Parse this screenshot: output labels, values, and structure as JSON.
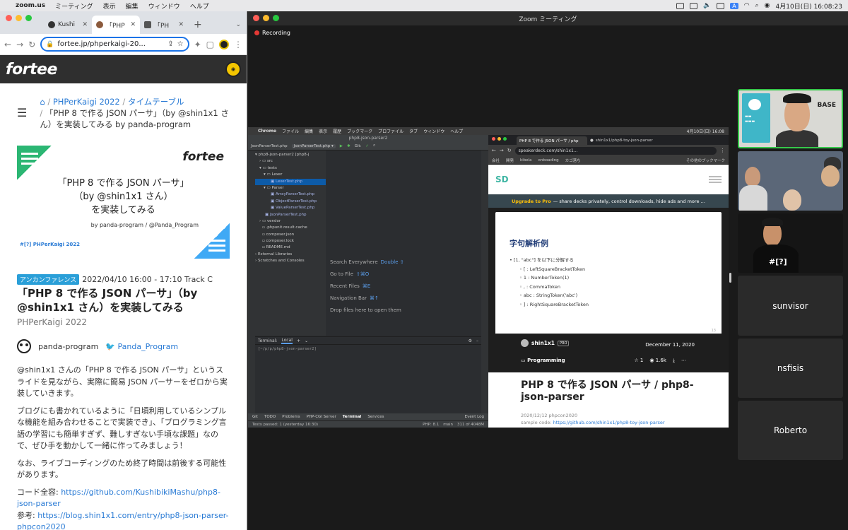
{
  "menubar": {
    "app": "zoom.us",
    "items": [
      "ミーティング",
      "表示",
      "編集",
      "ウィンドウ",
      "ヘルプ"
    ],
    "datetime": "4月10日(日)  16:08:23",
    "input_badge": "A"
  },
  "browser": {
    "tabs": [
      {
        "label": "Kushi"
      },
      {
        "label": "「PHP"
      },
      {
        "label": "「PH"
      }
    ],
    "url": "fortee.jp/phperkaigi-20...",
    "site_logo": "fortee",
    "breadcrumb": {
      "item1": "PHPerKaigi 2022",
      "item2": "タイムテーブル",
      "current": "「PHP 8 で作る JSON パーサ」（by @shin1x1 さん）を実装してみる by panda-program"
    },
    "banner": {
      "brand": "fortee",
      "line1": "「PHP 8 で作る JSON パーサ」",
      "line2": "（by @shin1x1 さん）",
      "line3": "を実装してみる",
      "author": "by panda-program / @Panda_Program",
      "event": "#[?] PHPerKaigi 2022"
    },
    "talk": {
      "badge": "アンカンファレンス",
      "when": "2022/04/10 16:00 - 17:10 Track C",
      "title": "「PHP 8 で作る JSON パーサ」（by @shin1x1 さん）を実装してみる",
      "event": "PHPerKaigi 2022",
      "speaker": "panda-program",
      "twitter": "Panda_Program"
    },
    "desc": {
      "p1": "@shin1x1 さんの「PHP 8 で作る JSON パーサ」というスライドを見ながら、実際に簡易 JSON パーサーをゼロから実装していきます。",
      "p2": "ブログにも書かれているように「日頃利用しているシンプルな機能を組み合わせることで実装でき」、「プログラミング言語の学習にも簡単すぎず、難しすぎない手頃な課題」なので、ぜひ手を動かして一緒に作ってみましょう！",
      "p3": "なお、ライブコーディングのため終了時間は前後する可能性があります。",
      "code_label": "コード全容: ",
      "code_link": "https://github.com/KushibikiMashu/php8-json-parser",
      "ref_label": "参考: ",
      "ref_link": "https://blog.shin1x1.com/entry/php8-json-parser-phpcon2020"
    }
  },
  "zoom": {
    "title": "Zoom ミーティング",
    "recording": "Recording",
    "participants": [
      "sunvisor",
      "nsfisis",
      "Roberto"
    ],
    "tile1_logo": "BASE"
  },
  "share": {
    "menubar": {
      "app": "Chrome",
      "items": [
        "ファイル",
        "編集",
        "表示",
        "履歴",
        "ブックマーク",
        "プロファイル",
        "タブ",
        "ウィンドウ",
        "ヘルプ"
      ],
      "datetime": "4月10日(日)  16:08"
    },
    "ide": {
      "title": "php8-json-parser2",
      "file_tab": "JsonParserTest.php",
      "run_config": "JsonParserTest.php ▾",
      "tree": [
        "php8-json-parser2 [php8-j",
        "src",
        "tests",
        "Lexer",
        "LexerTest.php",
        "Parser",
        "ArrayParserTest.php",
        "ObjectParserTest.php",
        "ValueParserTest.php",
        "JsonParserTest.php",
        "vendor",
        ".phpunit.result.cache",
        "composer.json",
        "composer.lock",
        "README.md",
        "External Libraries",
        "Scratches and Consoles"
      ],
      "hints": [
        {
          "label": "Search Everywhere",
          "key": "Double ⇧"
        },
        {
          "label": "Go to File",
          "key": "⇧⌘O"
        },
        {
          "label": "Recent Files",
          "key": "⌘E"
        },
        {
          "label": "Navigation Bar",
          "key": "⌘↑"
        },
        {
          "label": "Drop files here to open them",
          "key": ""
        }
      ],
      "terminal_tab": "Terminal:",
      "terminal_local": "Local",
      "terminal_line": "[~/p/p/php8-json-parser2] ",
      "bottom_tabs": [
        "Git",
        "TODO",
        "Problems",
        "PHP-CGI Server",
        "Terminal",
        "Services",
        "Event Log"
      ],
      "status": "Tests passed: 1 (yesterday 16:30)",
      "status_right": [
        "PHP: 8.1",
        "main",
        "311 of 4048M"
      ]
    },
    "chrome": {
      "tabs": [
        "PHP 8 で作る JSON パーサ / php",
        "shin1x1/php8-toy-json-parser"
      ],
      "url": "speakerdeck.com/shin1x1...",
      "bookmarks": [
        "会社",
        "開発",
        "kibela",
        "onboading",
        "カゴ落ち",
        "その他のブックマーク"
      ],
      "logo": "SD",
      "upgrade_hl": "Upgrade to Pro",
      "upgrade_rest": "— share decks privately, control downloads, hide ads and more …",
      "slide": {
        "title": "字句解析例",
        "items": [
          "[1, \"abc\"] を以下に分解する",
          "[ : LeftSquareBracketToken",
          "1 : NumberToken(1)",
          ", : CommaToken",
          "abc : StringToken('abc')",
          "] : RightSquareBracketToken"
        ],
        "num": "13"
      },
      "deck": {
        "author": "shin1x1",
        "pro": "PRO",
        "date": "December 11, 2020",
        "category": "Programming",
        "stars": "1",
        "views": "1.6k",
        "title": "PHP 8 で作る JSON パーサ / php8-json-parser",
        "sub": "2020/12/12 phpcon2020",
        "sample_label": "sample code: ",
        "sample_link": "https://github.com/shin1x1/php8-toy-json-parser"
      }
    }
  }
}
